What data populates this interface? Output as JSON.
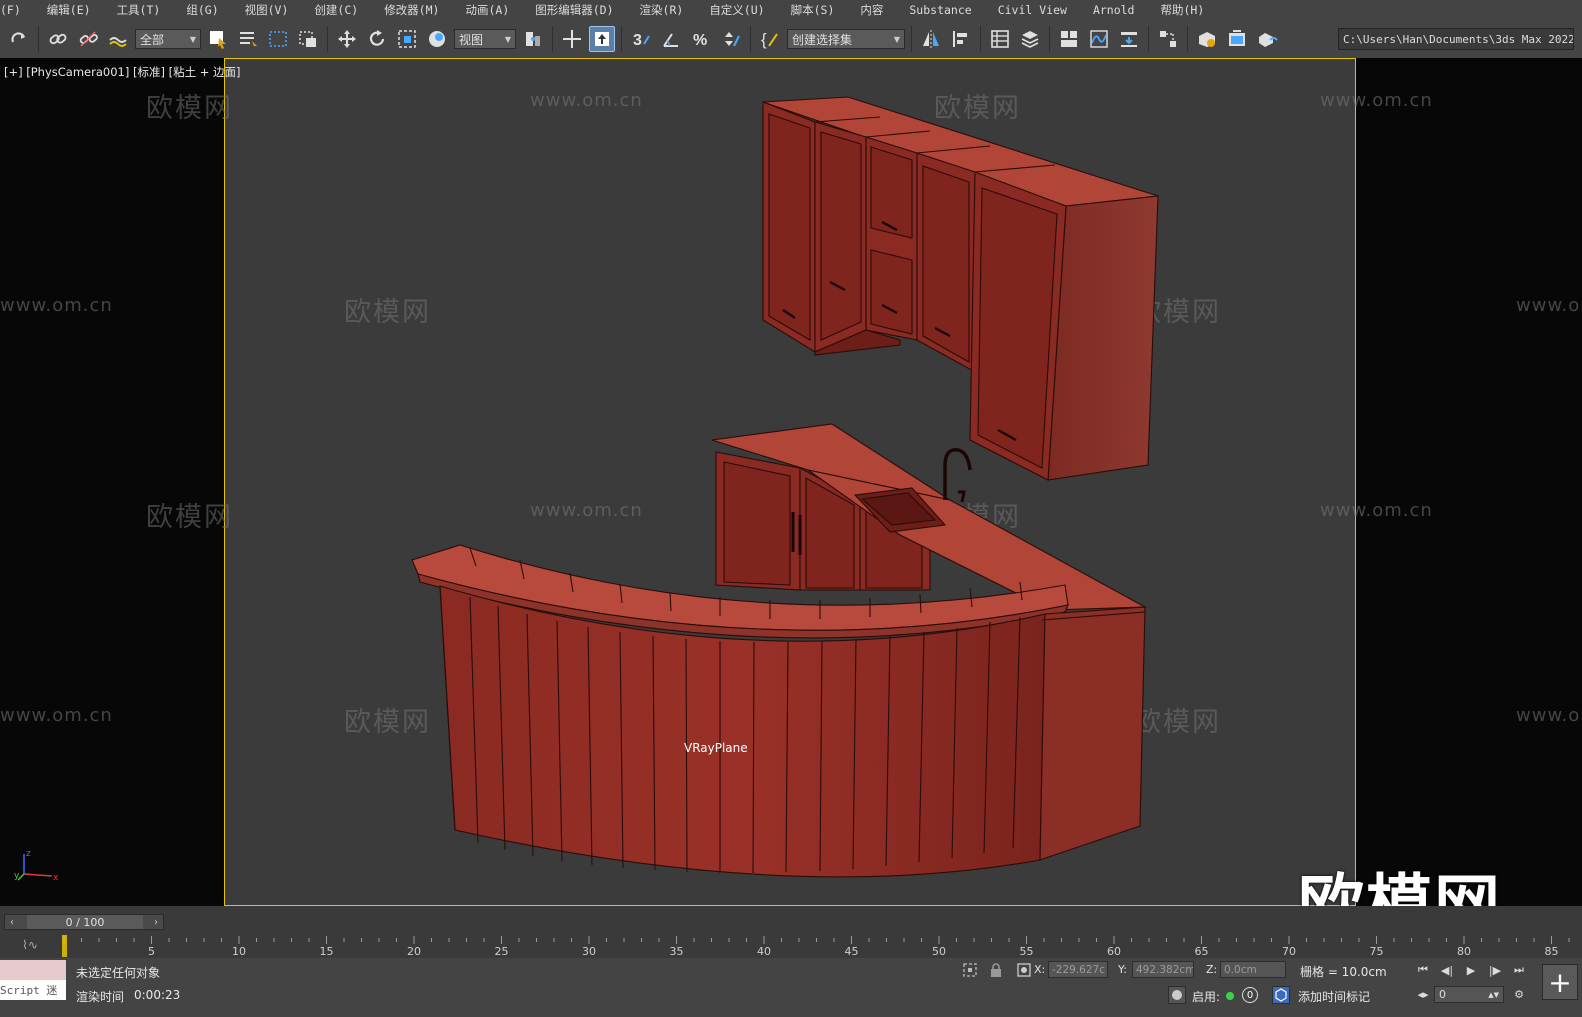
{
  "menu": [
    "(F)",
    "编辑(E)",
    "工具(T)",
    "组(G)",
    "视图(V)",
    "创建(C)",
    "修改器(M)",
    "动画(A)",
    "图形编辑器(D)",
    "渲染(R)",
    "自定义(U)",
    "脚本(S)",
    "内容",
    "Substance",
    "Civil View",
    "Arnold",
    "帮助(H)"
  ],
  "toolbar": {
    "filter_value": "全部",
    "coord_value": "视图",
    "selection_set_placeholder": "创建选择集",
    "path_value": "C:\\Users\\Han\\Documents\\3ds Max 2022"
  },
  "viewport": {
    "label": "[+] [PhysCamera001] [标准] [粘土 + 边面]",
    "object_label": "VRayPlane",
    "watermark_cn": "欧模网",
    "watermark_url": "www.om.cn",
    "big_logo": "欧模网",
    "axis": {
      "z": "z",
      "x": "x",
      "y": "y"
    }
  },
  "timeline": {
    "slider_value": "0 / 100",
    "ticks": [
      "5",
      "10",
      "15",
      "20",
      "25",
      "30",
      "35",
      "40",
      "45",
      "50",
      "55",
      "60",
      "65",
      "70",
      "75",
      "80",
      "85"
    ]
  },
  "status": {
    "maxscript_text": "Script 迷",
    "message": "未选定任何对象",
    "render_time_label": "渲染时间",
    "render_time_value": "0:00:23",
    "x_label": "X:",
    "x_value": "-229.627c",
    "y_label": "Y:",
    "y_value": "492.382cm",
    "z_label": "Z:",
    "z_value": "0.0cm",
    "grid": "栅格 = 10.0cm",
    "enable_label": "启用:",
    "enable_count": "0",
    "add_tag": "添加时间标记",
    "frame_value": "0"
  },
  "colors": {
    "cabinet": "#8f2a22",
    "cabinet_light": "#b5473b",
    "cabinet_dark": "#6e1e18",
    "selection_border": "#e8c400"
  }
}
